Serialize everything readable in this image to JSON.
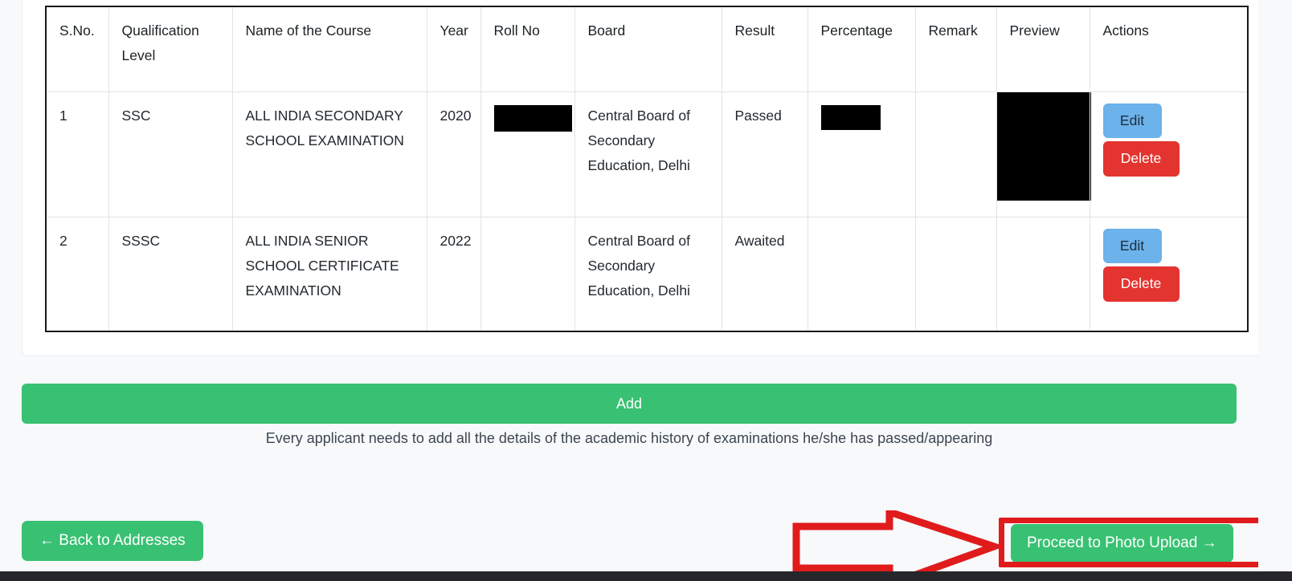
{
  "table": {
    "columns": [
      "S.No.",
      "Qualification Level",
      "Name of the Course",
      "Year",
      "Roll No",
      "Board",
      "Result",
      "Percentage",
      "Remark",
      "Preview",
      "Actions"
    ],
    "rows": [
      {
        "sno": "1",
        "qualification_level": "SSC",
        "course_name": "ALL INDIA SECONDARY SCHOOL EXAMINATION",
        "year": "2020",
        "roll_no": "",
        "roll_no_redacted": true,
        "board": "Central Board of Secondary Education, Delhi",
        "result": "Passed",
        "percentage": "",
        "percentage_redacted": true,
        "remark": "",
        "preview": "",
        "preview_redacted": true,
        "edit_label": "Edit",
        "delete_label": "Delete"
      },
      {
        "sno": "2",
        "qualification_level": "SSSC",
        "course_name": "ALL INDIA SENIOR SCHOOL CERTIFICATE EXAMINATION",
        "year": "2022",
        "roll_no": "",
        "roll_no_redacted": false,
        "board": "Central Board of Secondary Education, Delhi",
        "result": "Awaited",
        "percentage": "",
        "percentage_redacted": false,
        "remark": "",
        "preview": "",
        "preview_redacted": false,
        "edit_label": "Edit",
        "delete_label": "Delete"
      }
    ]
  },
  "add_button": {
    "label": "Add"
  },
  "helper_text": "Every applicant needs to add all the details of the academic history of examinations he/she has passed/appearing",
  "footer": {
    "back_label": "← Back to Addresses",
    "proceed_label": "Proceed to Photo Upload →"
  },
  "annotation": {
    "arrow_color": "#e01b1b",
    "highlight_color": "#e01b1b"
  },
  "colors": {
    "primary_green": "#38c172",
    "edit_blue": "#6cb2eb",
    "delete_red": "#e3342f",
    "page_background": "#f7f9fb",
    "table_border": "#12181c"
  }
}
